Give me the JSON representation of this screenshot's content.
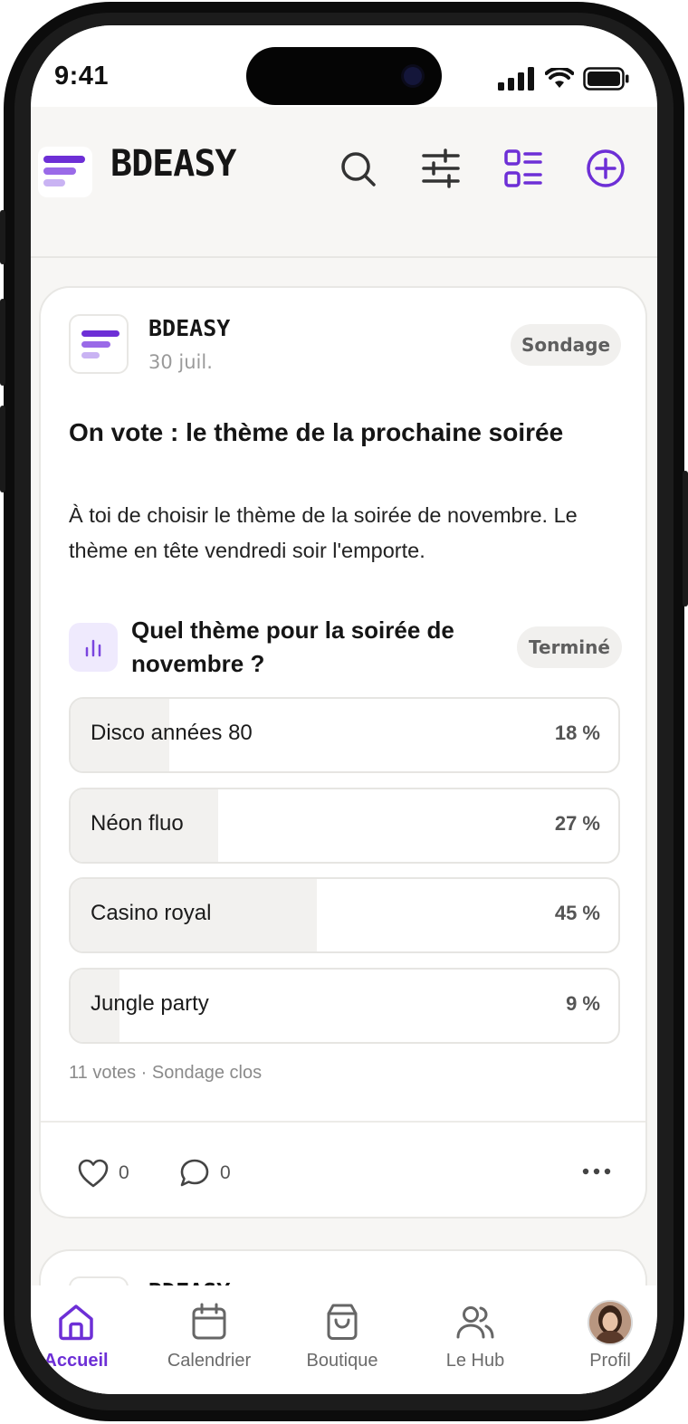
{
  "status_bar": {
    "time": "9:41"
  },
  "app_bar": {
    "brand": "BDEASY",
    "icons": [
      "search-icon",
      "sliders-icon",
      "list-view-icon",
      "plus-circle-icon"
    ],
    "accent_color": "#6d2fd6"
  },
  "post": {
    "author": "BDEASY",
    "date": "30 juil.",
    "type_badge": "Sondage",
    "title": "On vote : le thème de la prochaine soirée",
    "body": "À toi de choisir le thème de la soirée de novembre. Le thème en tête vendredi soir l'emporte.",
    "poll": {
      "question": "Quel thème pour la soirée de novembre ?",
      "status_badge": "Terminé",
      "options": [
        {
          "label": "Disco années 80",
          "percent_label": "18 %",
          "percent": 18
        },
        {
          "label": "Néon fluo",
          "percent_label": "27 %",
          "percent": 27
        },
        {
          "label": "Casino royal",
          "percent_label": "45 %",
          "percent": 45
        },
        {
          "label": "Jungle party",
          "percent_label": "9 %",
          "percent": 9
        }
      ],
      "meta": "11 votes · Sondage clos"
    },
    "likes": "0",
    "comments": "0"
  },
  "next_post": {
    "author": "BDEASY"
  },
  "tab_bar": {
    "tabs": [
      {
        "label": "Accueil",
        "icon": "home-icon",
        "active": true
      },
      {
        "label": "Calendrier",
        "icon": "calendar-icon",
        "active": false
      },
      {
        "label": "Boutique",
        "icon": "shopping-bag-icon",
        "active": false
      },
      {
        "label": "Le Hub",
        "icon": "users-icon",
        "active": false
      },
      {
        "label": "Profil",
        "icon": "avatar",
        "active": false
      }
    ]
  }
}
